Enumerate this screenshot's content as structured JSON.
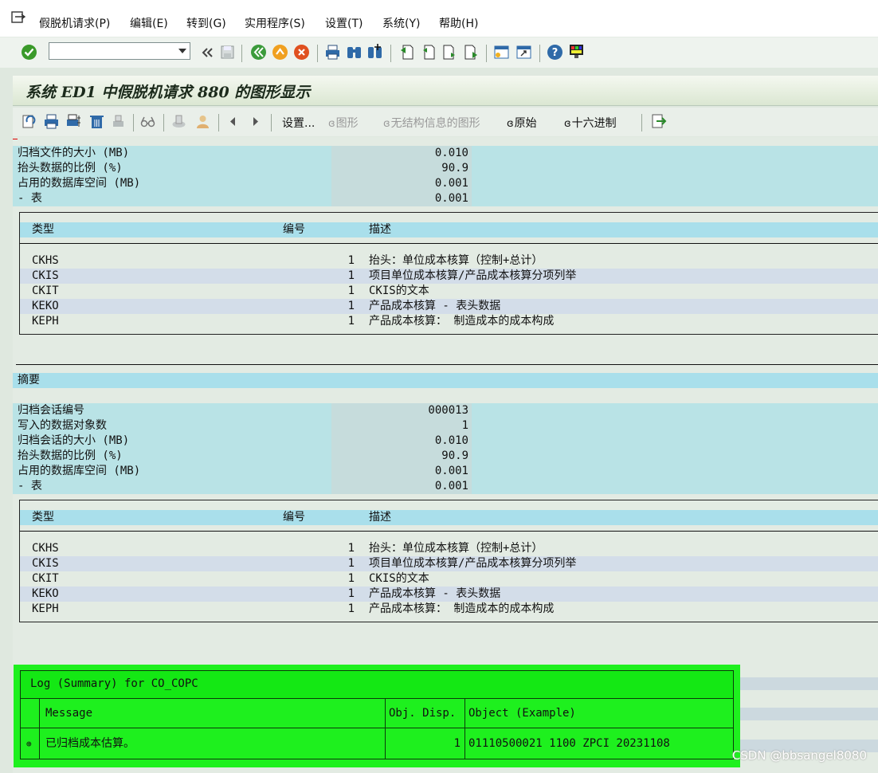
{
  "menu": {
    "items": [
      "假脱机请求(P)",
      "编辑(E)",
      "转到(G)",
      "实用程序(S)",
      "设置(T)",
      "系统(Y)",
      "帮助(H)"
    ]
  },
  "toolbar": {
    "command_value": "",
    "icons": [
      "enter-icon",
      "back-double-icon",
      "save-icon",
      "back-icon",
      "exit-icon",
      "cancel-icon",
      "print-icon",
      "find-icon",
      "find-next-icon",
      "first-page-icon",
      "prev-page-icon",
      "next-page-icon",
      "last-page-icon",
      "new-session-icon",
      "shortcut-icon",
      "help-icon",
      "layout-icon"
    ]
  },
  "title": "系统 ED1 中假脱机请求 880 的图形显示",
  "app_toolbar": {
    "settings": "设置...",
    "graphic": "图形",
    "graphic_nostruct": "无结构信息的图形",
    "raw": "原始",
    "hex": "十六进制"
  },
  "block1": {
    "rows": [
      {
        "label": "归档文件的大小 (MB)",
        "value": "0.010"
      },
      {
        "label": "抬头数据的比例 (%)",
        "value": "90.9"
      },
      {
        "label": "占用的数据库空间 (MB)",
        "value": "0.001"
      },
      {
        "label": "- 表",
        "value": "0.001"
      }
    ]
  },
  "table_headers": {
    "type": "类型",
    "number": "编号",
    "desc": "描述"
  },
  "table1": [
    {
      "type": "CKHS",
      "num": "1",
      "desc": "抬头：单位成本核算（控制+总计）"
    },
    {
      "type": "CKIS",
      "num": "1",
      "desc": "项目单位成本核算/产品成本核算分项列举"
    },
    {
      "type": "CKIT",
      "num": "1",
      "desc": "CKIS的文本"
    },
    {
      "type": "KEKO",
      "num": "1",
      "desc": "产品成本核算 - 表头数据"
    },
    {
      "type": "KEPH",
      "num": "1",
      "desc": "产品成本核算： 制造成本的成本构成"
    }
  ],
  "summary": {
    "heading": "摘要",
    "rows": [
      {
        "label": "归档会话编号",
        "value": "000013"
      },
      {
        "label": "写入的数据对象数",
        "value": "1"
      },
      {
        "label": "归档会话的大小 (MB)",
        "value": "0.010"
      },
      {
        "label": "抬头数据的比例 (%)",
        "value": "90.9"
      },
      {
        "label": "占用的数据库空间 (MB)",
        "value": "0.001"
      },
      {
        "label": "- 表",
        "value": "0.001"
      }
    ]
  },
  "table2": [
    {
      "type": "CKHS",
      "num": "1",
      "desc": "抬头：单位成本核算（控制+总计）"
    },
    {
      "type": "CKIS",
      "num": "1",
      "desc": "项目单位成本核算/产品成本核算分项列举"
    },
    {
      "type": "CKIT",
      "num": "1",
      "desc": "CKIS的文本"
    },
    {
      "type": "KEKO",
      "num": "1",
      "desc": "产品成本核算 - 表头数据"
    },
    {
      "type": "KEPH",
      "num": "1",
      "desc": "产品成本核算： 制造成本的成本构成"
    }
  ],
  "log": {
    "title": "Log (Summary) for CO_COPC",
    "headers": {
      "message": "Message",
      "obj": "Obj. Disp.",
      "object": "Object (Example)"
    },
    "row": {
      "icon": "expand-icon",
      "message": "已归档成本估算。",
      "obj": "1",
      "object": "01110500021 1100 ZPCI 20231108"
    }
  },
  "watermark": "CSDN @bbsangel8080",
  "colors": {
    "accent_band": "#a9dfeb",
    "log_green": "#1ef01e",
    "background": "#e3ebe3"
  }
}
